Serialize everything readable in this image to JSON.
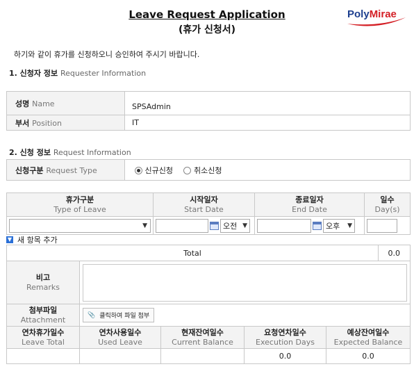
{
  "header": {
    "title_en": "Leave Request Application",
    "title_ko": "(휴가 신청서)",
    "logo_poly": "Poly",
    "logo_mirae": "Mirae"
  },
  "intro": "하기와 같이 휴가를 신청하오니 승인하여 주시기 바랍니다.",
  "section1": {
    "title_ko": "1. 신청자 정보",
    "title_en": "Requester Information",
    "rows": [
      {
        "label_ko": "성명",
        "label_en": "Name",
        "value": "SPSAdmin"
      },
      {
        "label_ko": "부서",
        "label_en": "Position",
        "value": "IT"
      }
    ]
  },
  "section2": {
    "title_ko": "2. 신청 정보",
    "title_en": "Request Information",
    "request_type_ko": "신청구분",
    "request_type_en": "Request Type",
    "option_new": "신규신청",
    "option_cancel": "취소신청",
    "selected": "신규신청"
  },
  "leave_table": {
    "col_type_ko": "휴가구분",
    "col_type_en": "Type of Leave",
    "col_start_ko": "시작일자",
    "col_start_en": "Start Date",
    "col_end_ko": "종료일자",
    "col_end_en": "End Date",
    "col_days_ko": "일수",
    "col_days_en": "Day(s)",
    "start_ampm": "오전",
    "end_ampm": "오후",
    "add_item": "새 항목 추가",
    "total_label": "Total",
    "total_value": "0.0"
  },
  "remarks": {
    "label_ko": "비고",
    "label_en": "Remarks"
  },
  "attachment": {
    "label_ko": "첨부파일",
    "label_en": "Attachment",
    "button": "클릭하여 파일 첨부"
  },
  "balance": {
    "cols": [
      {
        "ko": "연차휴가일수",
        "en": "Leave Total",
        "value": ""
      },
      {
        "ko": "연차사용일수",
        "en": "Used Leave",
        "value": ""
      },
      {
        "ko": "현재잔여일수",
        "en": "Current Balance",
        "value": ""
      },
      {
        "ko": "요청연차일수",
        "en": "Execution Days",
        "value": "0.0"
      },
      {
        "ko": "예상잔여일수",
        "en": "Expected Balance",
        "value": "0.0"
      }
    ]
  },
  "colors": {
    "logo_blue": "#1d3f8f",
    "logo_red": "#d42026",
    "header_bg": "#f3f3f3",
    "border": "#c8c8c8"
  }
}
